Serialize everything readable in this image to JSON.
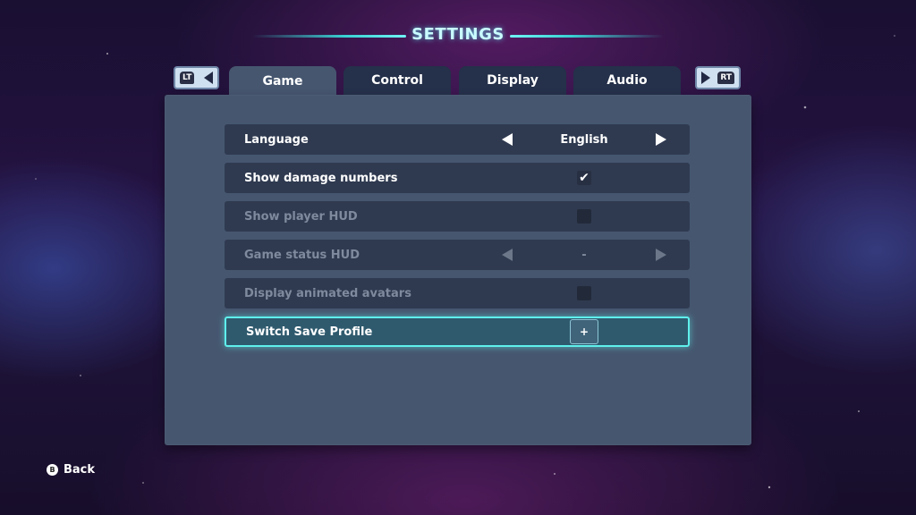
{
  "header": {
    "title": "SETTINGS"
  },
  "bumpers": {
    "left_tag": "LT",
    "right_tag": "RT"
  },
  "tabs": [
    {
      "label": "Game",
      "active": true
    },
    {
      "label": "Control",
      "active": false
    },
    {
      "label": "Display",
      "active": false
    },
    {
      "label": "Audio",
      "active": false
    }
  ],
  "settings": [
    {
      "label": "Language",
      "type": "selector",
      "value": "English",
      "enabled": true
    },
    {
      "label": "Show damage numbers",
      "type": "checkbox",
      "checked": true,
      "check_glyph": "✔",
      "enabled": true
    },
    {
      "label": "Show player HUD",
      "type": "checkbox",
      "checked": false,
      "enabled": false
    },
    {
      "label": "Game status HUD",
      "type": "selector",
      "value": "-",
      "enabled": false
    },
    {
      "label": "Display animated avatars",
      "type": "checkbox",
      "checked": false,
      "enabled": false
    },
    {
      "label": "Switch Save Profile",
      "type": "button",
      "button_label": "+",
      "selected": true,
      "enabled": true
    }
  ],
  "footer": {
    "back_button_glyph": "B",
    "back_label": "Back"
  },
  "colors": {
    "accent": "#5ff0ec",
    "panel": "#46566f",
    "row": "#2f3a50"
  }
}
